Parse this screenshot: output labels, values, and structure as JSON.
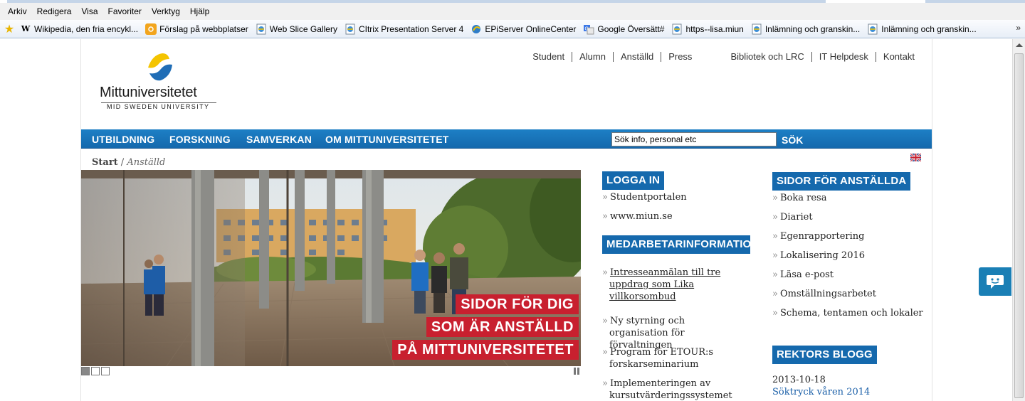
{
  "browser": {
    "menu": [
      "Arkiv",
      "Redigera",
      "Visa",
      "Favoriter",
      "Verktyg",
      "Hjälp"
    ],
    "favorites": [
      {
        "label": "Wikipedia, den fria encykl...",
        "icon": "wikipedia-icon"
      },
      {
        "label": "Förslag på webbplatser",
        "icon": "suggested-sites-icon"
      },
      {
        "label": "Web Slice Gallery",
        "icon": "web-slice-icon"
      },
      {
        "label": "CItrix Presentation Server 4",
        "icon": "ie-page-icon"
      },
      {
        "label": "EPiServer OnlineCenter",
        "icon": "episerver-icon"
      },
      {
        "label": "Google Översätt#",
        "icon": "google-translate-icon"
      },
      {
        "label": "https--lisa.miun",
        "icon": "ie-page-icon"
      },
      {
        "label": "Inlämning och granskin...",
        "icon": "ie-page-icon"
      },
      {
        "label": "Inlämning och granskin...",
        "icon": "ie-page-icon"
      }
    ],
    "more": "»"
  },
  "site": {
    "logo_name": "Mittuniversitetet",
    "logo_sub": "MID SWEDEN UNIVERSITY",
    "toplinks_left": [
      "Student",
      "Alumn",
      "Anställd",
      "Press"
    ],
    "toplinks_right": [
      "Bibliotek och LRC",
      "IT Helpdesk",
      "Kontakt"
    ],
    "nav": [
      "UTBILDNING",
      "FORSKNING",
      "SAMVERKAN",
      "OM MITTUNIVERSITETET"
    ],
    "search_value": "Sök info, personal etc",
    "search_button": "SÖK",
    "breadcrumb_start": "Start",
    "breadcrumb_sep": " / ",
    "breadcrumb_current": "Anställd",
    "hero_banner": [
      "SIDOR FÖR DIG",
      "SOM ÄR ANSTÄLLD",
      "PÅ MITTUNIVERSITETET"
    ]
  },
  "login": {
    "title": "LOGGA IN",
    "links": [
      "Studentportalen",
      "www.miun.se"
    ]
  },
  "staffinfo": {
    "title": "MEDARBETARINFORMATION",
    "items": [
      "Intresseanmälan till tre uppdrag som Lika villkorsombud",
      "Ny styrning och organisation för förvaltningen",
      "Program för ETOUR:s forskarseminarium",
      "Implementeringen av kursutvärderingssystemet"
    ]
  },
  "staffpages": {
    "title": "SIDOR FÖR ANSTÄLLDA",
    "links": [
      "Boka resa",
      "Diariet",
      "Egenrapportering",
      "Lokalisering 2016",
      "Läsa e-post",
      "Omställningsarbetet",
      "Schema, tentamen och lokaler"
    ]
  },
  "blog": {
    "title": "REKTORS BLOGG",
    "date": "2013-10-18",
    "post": "Söktryck våren 2014"
  },
  "chevron": "»",
  "colors": {
    "nav_blue": "#1569ad",
    "banner_red": "#c8202f",
    "logo_yellow": "#f4c400",
    "logo_blue": "#1f6db6"
  }
}
